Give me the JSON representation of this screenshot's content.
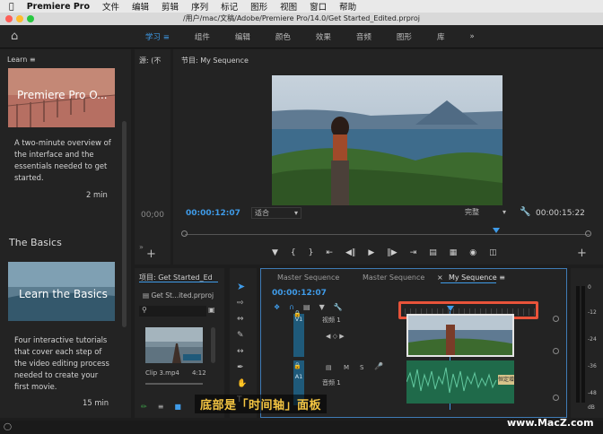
{
  "menubar": {
    "app": "Premiere Pro",
    "items": [
      "文件",
      "编辑",
      "剪辑",
      "序列",
      "标记",
      "图形",
      "视图",
      "窗口",
      "帮助"
    ]
  },
  "titlebar": {
    "title": "/用户/mac/文稿/Adobe/Premiere Pro/14.0/Get Started_Edited.prproj"
  },
  "workspace": {
    "tabs": [
      "学习",
      "组件",
      "编辑",
      "颜色",
      "效果",
      "音频",
      "图形",
      "库"
    ],
    "active_tab_index": 0,
    "overflow": "»"
  },
  "learn_panel": {
    "title": "Learn",
    "cards": [
      {
        "image_caption": "Premiere Pro O...",
        "description": "A two-minute overview of the interface and the essentials needed to get started.",
        "duration": "2 min"
      },
      {
        "image_caption": "Learn the Basics",
        "description": "Four interactive tutorials that cover each step of the video editing process needed to create your first movie.",
        "duration": "15 min"
      }
    ],
    "section_title": "The Basics"
  },
  "source_panel": {
    "title": "源: (不",
    "timecode": "00;00"
  },
  "program_monitor": {
    "title": "节目: My Sequence",
    "timecode": "00:00:12:07",
    "fit": "适合",
    "quality": "完整",
    "duration": "00:00:15:22"
  },
  "project_panel": {
    "title": "项目: Get Started_Ed",
    "file": "Get St...ited.prproj",
    "clip_name": "Clip 3.mp4",
    "clip_duration": "4:12"
  },
  "timeline": {
    "tabs": [
      "Master Sequence",
      "Master Sequence",
      "My Sequence"
    ],
    "active_tab_index": 2,
    "timecode": "00:00:12:07",
    "video_track": {
      "id": "V1",
      "name": "视频 1"
    },
    "audio_track": {
      "id": "A1",
      "name": "音频 1",
      "m": "M",
      "s": "S"
    },
    "clip_label": "恒定增"
  },
  "overlay": {
    "caption": "底部是「时间轴」面板",
    "watermark": "www.MacZ.com"
  },
  "meter_labels": [
    "0",
    "-12",
    "-24",
    "-36",
    "-48",
    "dB"
  ],
  "colors": {
    "accent": "#3f9be8",
    "highlight": "#e8533a",
    "track_blue": "#1f5a7a",
    "audio_green": "#1f6a4a"
  }
}
